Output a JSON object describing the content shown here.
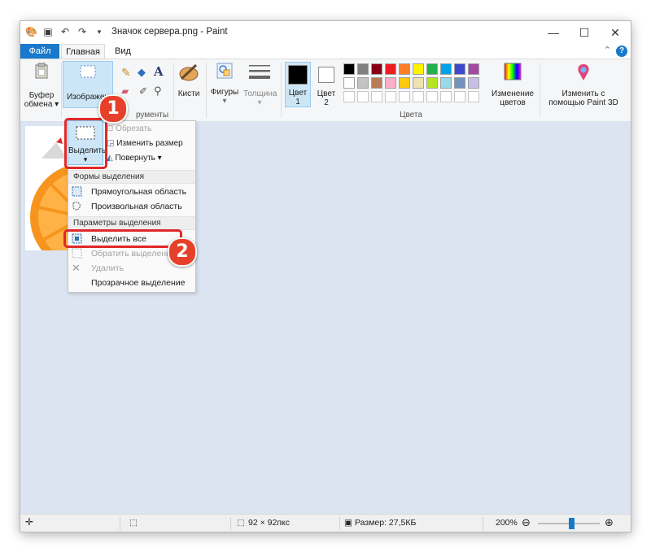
{
  "window": {
    "title": "Значок сервера.png - Paint"
  },
  "menu": {
    "file": "Файл",
    "home": "Главная",
    "view": "Вид",
    "help": "?"
  },
  "ribbon": {
    "clipboard": {
      "line1": "Буфер",
      "line2": "обмена"
    },
    "image": {
      "label": "Изображен"
    },
    "tools_group": "рументы",
    "brushes": "Кисти",
    "shapes": "Фигуры",
    "thickness": "Толщина",
    "color1": {
      "line1": "Цвет",
      "line2": "1"
    },
    "color2": {
      "line1": "Цвет",
      "line2": "2"
    },
    "edit_colors": {
      "line1": "Изменение",
      "line2": "цветов"
    },
    "paint3d": {
      "line1": "Изменить с",
      "line2": "помощью Paint 3D"
    },
    "colors_group": "Цвета",
    "palette_row1": [
      "#000000",
      "#7f7f7f",
      "#880015",
      "#ed1c24",
      "#ff7f27",
      "#fff200",
      "#22b14c",
      "#00a2e8",
      "#3f48cc",
      "#a349a4"
    ],
    "palette_row2": [
      "#ffffff",
      "#c3c3c3",
      "#b97a57",
      "#ffaec9",
      "#ffc90e",
      "#efe4b0",
      "#b5e61d",
      "#99d9ea",
      "#7092be",
      "#c8bfe7"
    ],
    "palette_row3": [
      "#ffffff",
      "#ffffff",
      "#ffffff",
      "#ffffff",
      "#ffffff",
      "#ffffff",
      "#ffffff",
      "#ffffff",
      "#ffffff",
      "#ffffff"
    ]
  },
  "select_menu": {
    "button_label": "Выделить",
    "crop": "Обрезать",
    "resize": "Изменить размер",
    "rotate": "Повернуть",
    "shapes_header": "Формы выделения",
    "rect": "Прямоугольная область",
    "freeform": "Произвольная область",
    "options_header": "Параметры выделения",
    "select_all": "Выделить все",
    "invert": "Обратить выделение",
    "delete": "Удалить",
    "transparent": "Прозрачное выделение"
  },
  "callouts": {
    "one": "1",
    "two": "2"
  },
  "status": {
    "size": "92 × 92пкс",
    "filesize": "Размер: 27,5КБ",
    "zoom": "200%",
    "zoom_level": 0.55
  }
}
